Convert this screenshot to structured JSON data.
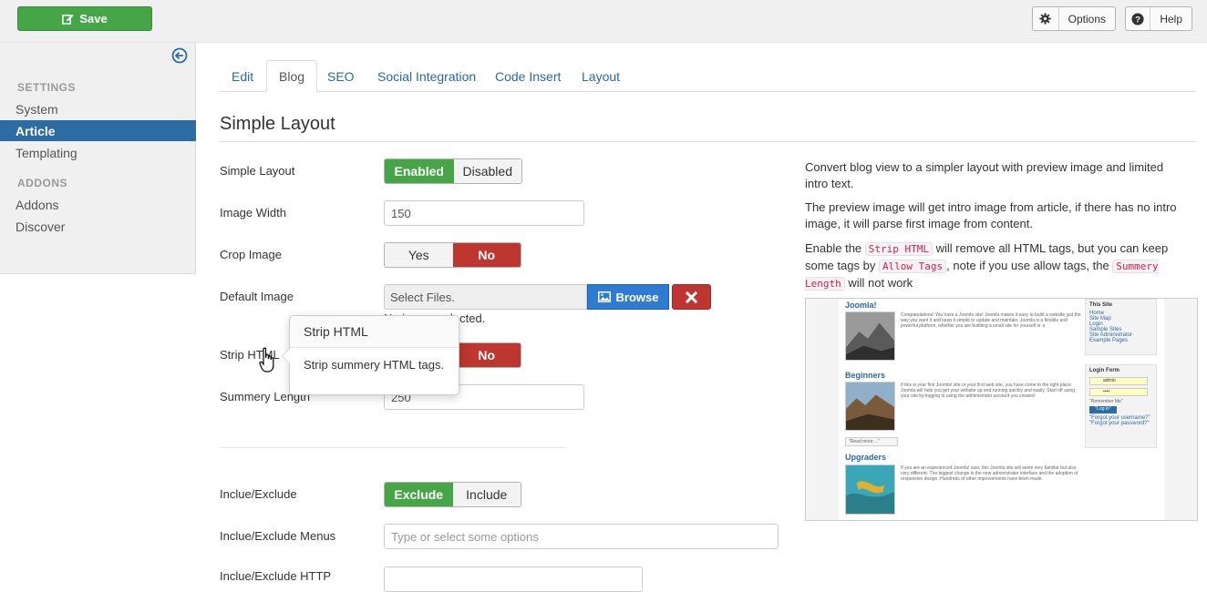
{
  "toolbar": {
    "save_label": "Save",
    "options_label": "Options",
    "help_label": "Help"
  },
  "sidebar": {
    "settings_heading": "SETTINGS",
    "settings_items": [
      "System",
      "Article",
      "Templating"
    ],
    "addons_heading": "ADDONS",
    "addons_items": [
      "Addons",
      "Discover"
    ]
  },
  "tabs": [
    "Edit",
    "Blog",
    "SEO",
    "Social Integration",
    "Code Insert",
    "Layout"
  ],
  "section_title": "Simple Layout",
  "form": {
    "simple_layout": {
      "label": "Simple Layout",
      "on": "Enabled",
      "off": "Disabled"
    },
    "image_width": {
      "label": "Image Width",
      "value": "150"
    },
    "crop_image": {
      "label": "Crop Image",
      "yes": "Yes",
      "no": "No"
    },
    "default_image": {
      "label": "Default Image",
      "value": "Select Files.",
      "browse": "Browse",
      "status": "No image selected."
    },
    "strip_html": {
      "label": "Strip HTML",
      "no": "No"
    },
    "summery_length": {
      "label": "Summery Length",
      "value": "250"
    },
    "include_exclude": {
      "label": "Inclue/Exclude",
      "exclude": "Exclude",
      "include": "Include"
    },
    "include_exclude_menus": {
      "label": "Inclue/Exclude Menus",
      "placeholder": "Type or select some options"
    },
    "include_exclude_http": {
      "label": "Inclue/Exclude HTTP"
    }
  },
  "tooltip": {
    "title": "Strip HTML",
    "body": "Strip summery HTML tags."
  },
  "description": {
    "p1": "Convert blog view to a simpler layout with preview image and limited intro text.",
    "p2": "The preview image will get intro image from article, if there has no intro image, it will parse first image from content.",
    "p3_a": "Enable the ",
    "p3_code1": "Strip HTML",
    "p3_b": " will remove all HTML tags, but you can keep some tags by ",
    "p3_code2": "Allow Tags",
    "p3_c": ", note if you use allow tags, the ",
    "p3_code3": "Summery Length",
    "p3_d": " will not work"
  },
  "preview": {
    "heading1": "Joomla!",
    "text1": "Congratulations! You have a Joomla site! Joomla makes it easy to build a website just the way you want it and keep it simple to update and maintain. Joomla is a flexible and powerful platform, whether you are building a small site for yourself or a",
    "heading2": "Beginners",
    "text2": "If this is your first Joomla! site or your first web site, you have come to the right place. Joomla will help you get your website up and running quickly and easily. Start off using your site by logging in using the administrator account you created",
    "read_more": "\"Read more ...\"",
    "heading3": "Upgraders",
    "text3": "If you are an experienced Joomla! user, this Joomla site will seem very familiar but also very different. The biggest change is the new administrator interface and the adoption of responsive design. Hundreds of other improvements have been made.",
    "this_site": "This Site",
    "site_links": [
      "Home",
      "Site Map",
      "Login",
      "Sample Sites",
      "Site Administrator",
      "Example Pages"
    ],
    "login_form": "Login Form",
    "username": "admin",
    "password": "••••",
    "remember": "\"Remember Me\"",
    "login_btn": "\"Log in\"",
    "forgot_user": "\"Forgot your username?\"",
    "forgot_pass": "\"Forgot your password?\""
  },
  "colors": {
    "save_green": "#46a546",
    "active_blue": "#2d6ca2",
    "no_red": "#bd362f",
    "browse_blue": "#2f7bd1",
    "link_blue": "#2a69a5"
  }
}
